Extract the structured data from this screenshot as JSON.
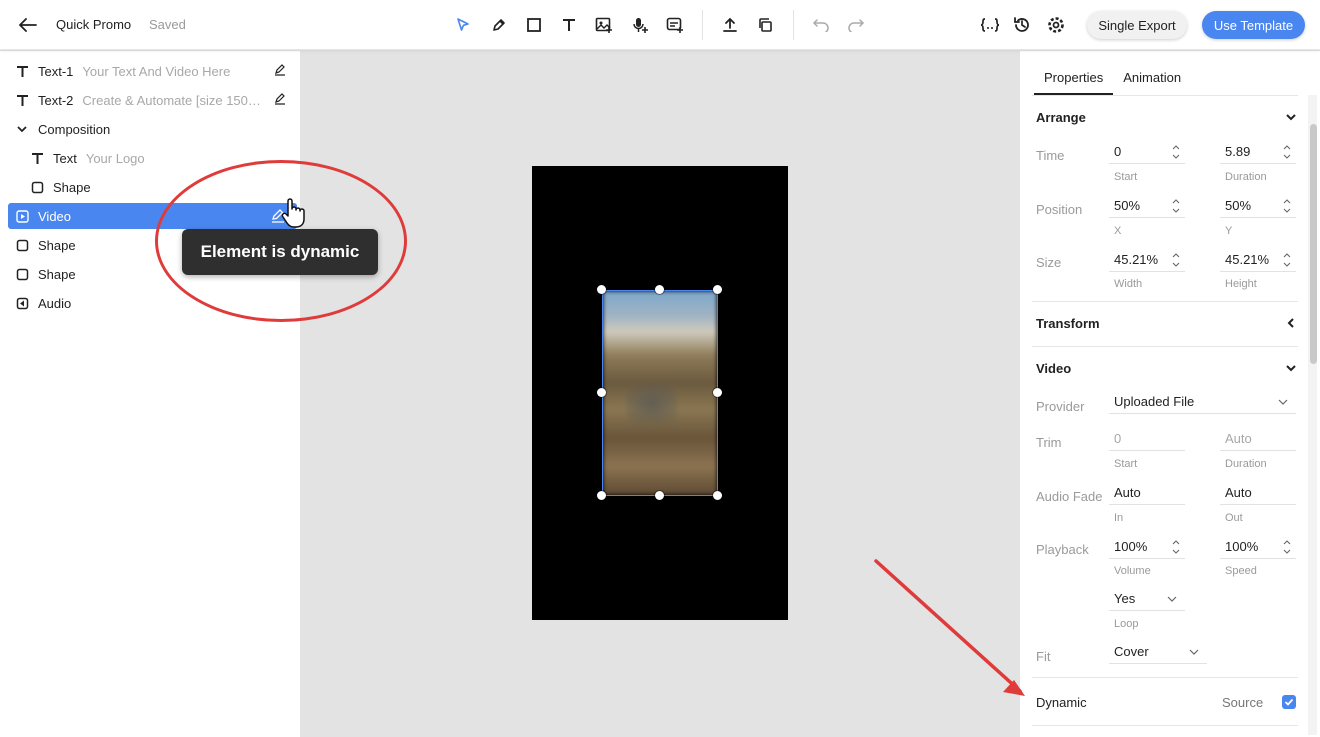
{
  "header": {
    "project_name": "Quick Promo",
    "save_status": "Saved",
    "single_export_label": "Single Export",
    "use_template_label": "Use Template",
    "accent_color": "#4a86f0"
  },
  "toolbar_icons": [
    "select-cursor-icon",
    "pen-icon",
    "rectangle-icon",
    "text-icon",
    "image-icon",
    "audio-mic-icon",
    "subtitles-icon",
    "upload-icon",
    "duplicate-icon",
    "undo-icon",
    "redo-icon",
    "variables-icon",
    "history-icon",
    "settings-icon"
  ],
  "layers": [
    {
      "name": "Text-1",
      "hint": "Your Text And Video Here",
      "icon": "text-icon"
    },
    {
      "name": "Text-2",
      "hint": "Create & Automate [size 150%...",
      "icon": "text-icon"
    },
    {
      "name": "Composition",
      "hint": "",
      "icon": "chevron-down-icon"
    },
    {
      "name": "Text",
      "hint": "Your Logo",
      "icon": "text-icon"
    },
    {
      "name": "Shape",
      "hint": "",
      "icon": "shape-icon"
    },
    {
      "name": "Video",
      "hint": "",
      "icon": "video-icon"
    },
    {
      "name": "Shape",
      "hint": "",
      "icon": "shape-icon"
    },
    {
      "name": "Shape",
      "hint": "",
      "icon": "shape-icon"
    },
    {
      "name": "Audio",
      "hint": "",
      "icon": "audio-icon"
    }
  ],
  "tooltip": "Element is dynamic",
  "properties": {
    "tabs": [
      "Properties",
      "Animation"
    ],
    "arrange": {
      "title": "Arrange",
      "time_label": "Time",
      "start_value": "0",
      "start_sub": "Start",
      "duration_value": "5.89",
      "duration_sub": "Duration",
      "position_label": "Position",
      "x_value": "50%",
      "x_sub": "X",
      "y_value": "50%",
      "y_sub": "Y",
      "size_label": "Size",
      "width_value": "45.21%",
      "width_sub": "Width",
      "height_value": "45.21%",
      "height_sub": "Height"
    },
    "transform": {
      "title": "Transform"
    },
    "video": {
      "title": "Video",
      "provider_label": "Provider",
      "provider_value": "Uploaded File",
      "trim_label": "Trim",
      "trim_start_value": "0",
      "trim_start_sub": "Start",
      "trim_duration_value": "Auto",
      "trim_duration_sub": "Duration",
      "audio_fade_label": "Audio Fade",
      "fade_in_value": "Auto",
      "fade_in_sub": "In",
      "fade_out_value": "Auto",
      "fade_out_sub": "Out",
      "playback_label": "Playback",
      "volume_value": "100%",
      "volume_sub": "Volume",
      "speed_value": "100%",
      "speed_sub": "Speed",
      "loop_value": "Yes",
      "loop_sub": "Loop",
      "fit_label": "Fit",
      "fit_value": "Cover"
    },
    "dynamic": {
      "title": "Dynamic",
      "source_label": "Source",
      "checked": true
    }
  }
}
